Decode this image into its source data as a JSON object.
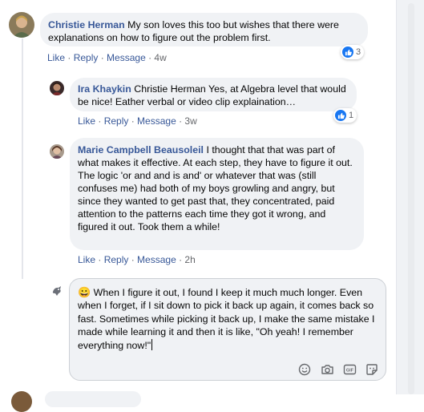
{
  "comments": [
    {
      "author": "Christie Herman",
      "text": " My son loves this too but wishes that there were explanations on how to figure out the problem first.",
      "actions": {
        "like": "Like",
        "reply": "Reply",
        "message": "Message",
        "time": "4w"
      },
      "reactions": "3"
    },
    {
      "author": "Ira Khaykin",
      "text": " Christie Herman Yes, at Algebra level that would be nice! Eather verbal or video clip explaination…",
      "actions": {
        "like": "Like",
        "reply": "Reply",
        "message": "Message",
        "time": "3w"
      },
      "reactions": "1"
    },
    {
      "author": "Marie Campbell Beausoleil",
      "text": " I thought that that was part of what makes it effective. At each step, they have to figure it out. The logic 'or and and is and' or whatever that was (still confuses me) had both of my boys growling and angry, but since they wanted to get past that, they concentrated, paid attention to the patterns each time they got it wrong, and figured it out. Took them a while!",
      "actions": {
        "like": "Like",
        "reply": "Reply",
        "message": "Message",
        "time": "2h"
      }
    }
  ],
  "composer": {
    "emoji": "😀",
    "text": " When I figure it out, I found I keep it much much longer. Even when I forget, if I sit down to pick it back up again, it comes back so fast.  Sometimes while picking it back up, I make the same mistake I made while learning it and then it is like, \"Oh yeah!  I remember everything now!\"",
    "tools": [
      "emoji-icon",
      "camera-icon",
      "gif-icon",
      "sticker-icon"
    ],
    "gif_label": "GIF"
  },
  "separator": " · "
}
